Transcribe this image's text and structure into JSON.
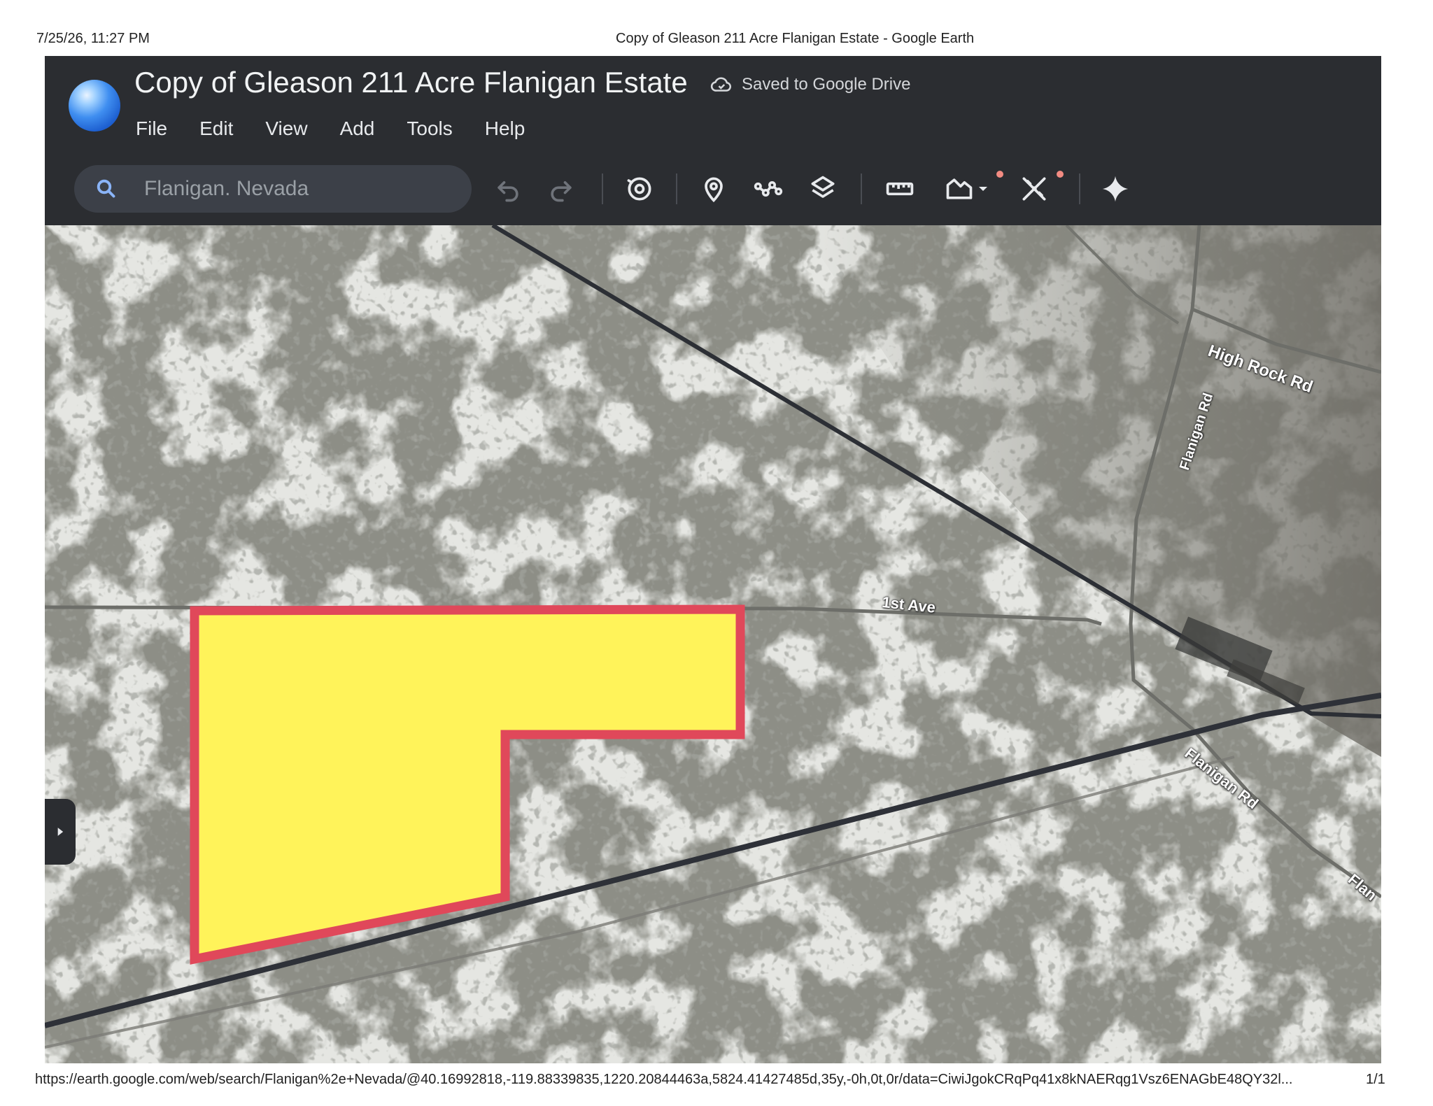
{
  "print": {
    "date": "7/25/26, 11:27 PM",
    "title": "Copy of Gleason 211 Acre Flanigan Estate - Google Earth",
    "url": "https://earth.google.com/web/search/Flanigan%2e+Nevada/@40.16992818,-119.88339835,1220.20844463a,5824.41427485d,35y,-0h,0t,0r/data=CiwiJgokCRqPq41x8kNAERqg1Vsz6ENAGbE48QY32l...",
    "page": "1/1"
  },
  "app": {
    "title": "Copy of Gleason 211 Acre Flanigan Estate",
    "saved_status": "Saved to Google Drive"
  },
  "menu": {
    "items": [
      {
        "label": "File"
      },
      {
        "label": "Edit"
      },
      {
        "label": "View"
      },
      {
        "label": "Add"
      },
      {
        "label": "Tools"
      },
      {
        "label": "Help"
      }
    ]
  },
  "search": {
    "value": "Flanigan. Nevada"
  },
  "toolbar": {
    "icons": [
      "undo-icon",
      "redo-icon",
      "history-icon",
      "placemark-icon",
      "path-icon",
      "layers-icon",
      "ruler-icon",
      "map-style-icon",
      "measure-icon",
      "sparkle-icon"
    ]
  },
  "map": {
    "labels": {
      "high_rock_rd": "High Rock Rd",
      "flanigan_rd_north": "Flanigan Rd",
      "first_ave": "1st Ave",
      "flanigan_rd_south": "Flanigan Rd",
      "flanigan_rd_edge": "Flan"
    },
    "parcel": {
      "fill": "#fff35a",
      "stroke": "#e0485a"
    }
  }
}
